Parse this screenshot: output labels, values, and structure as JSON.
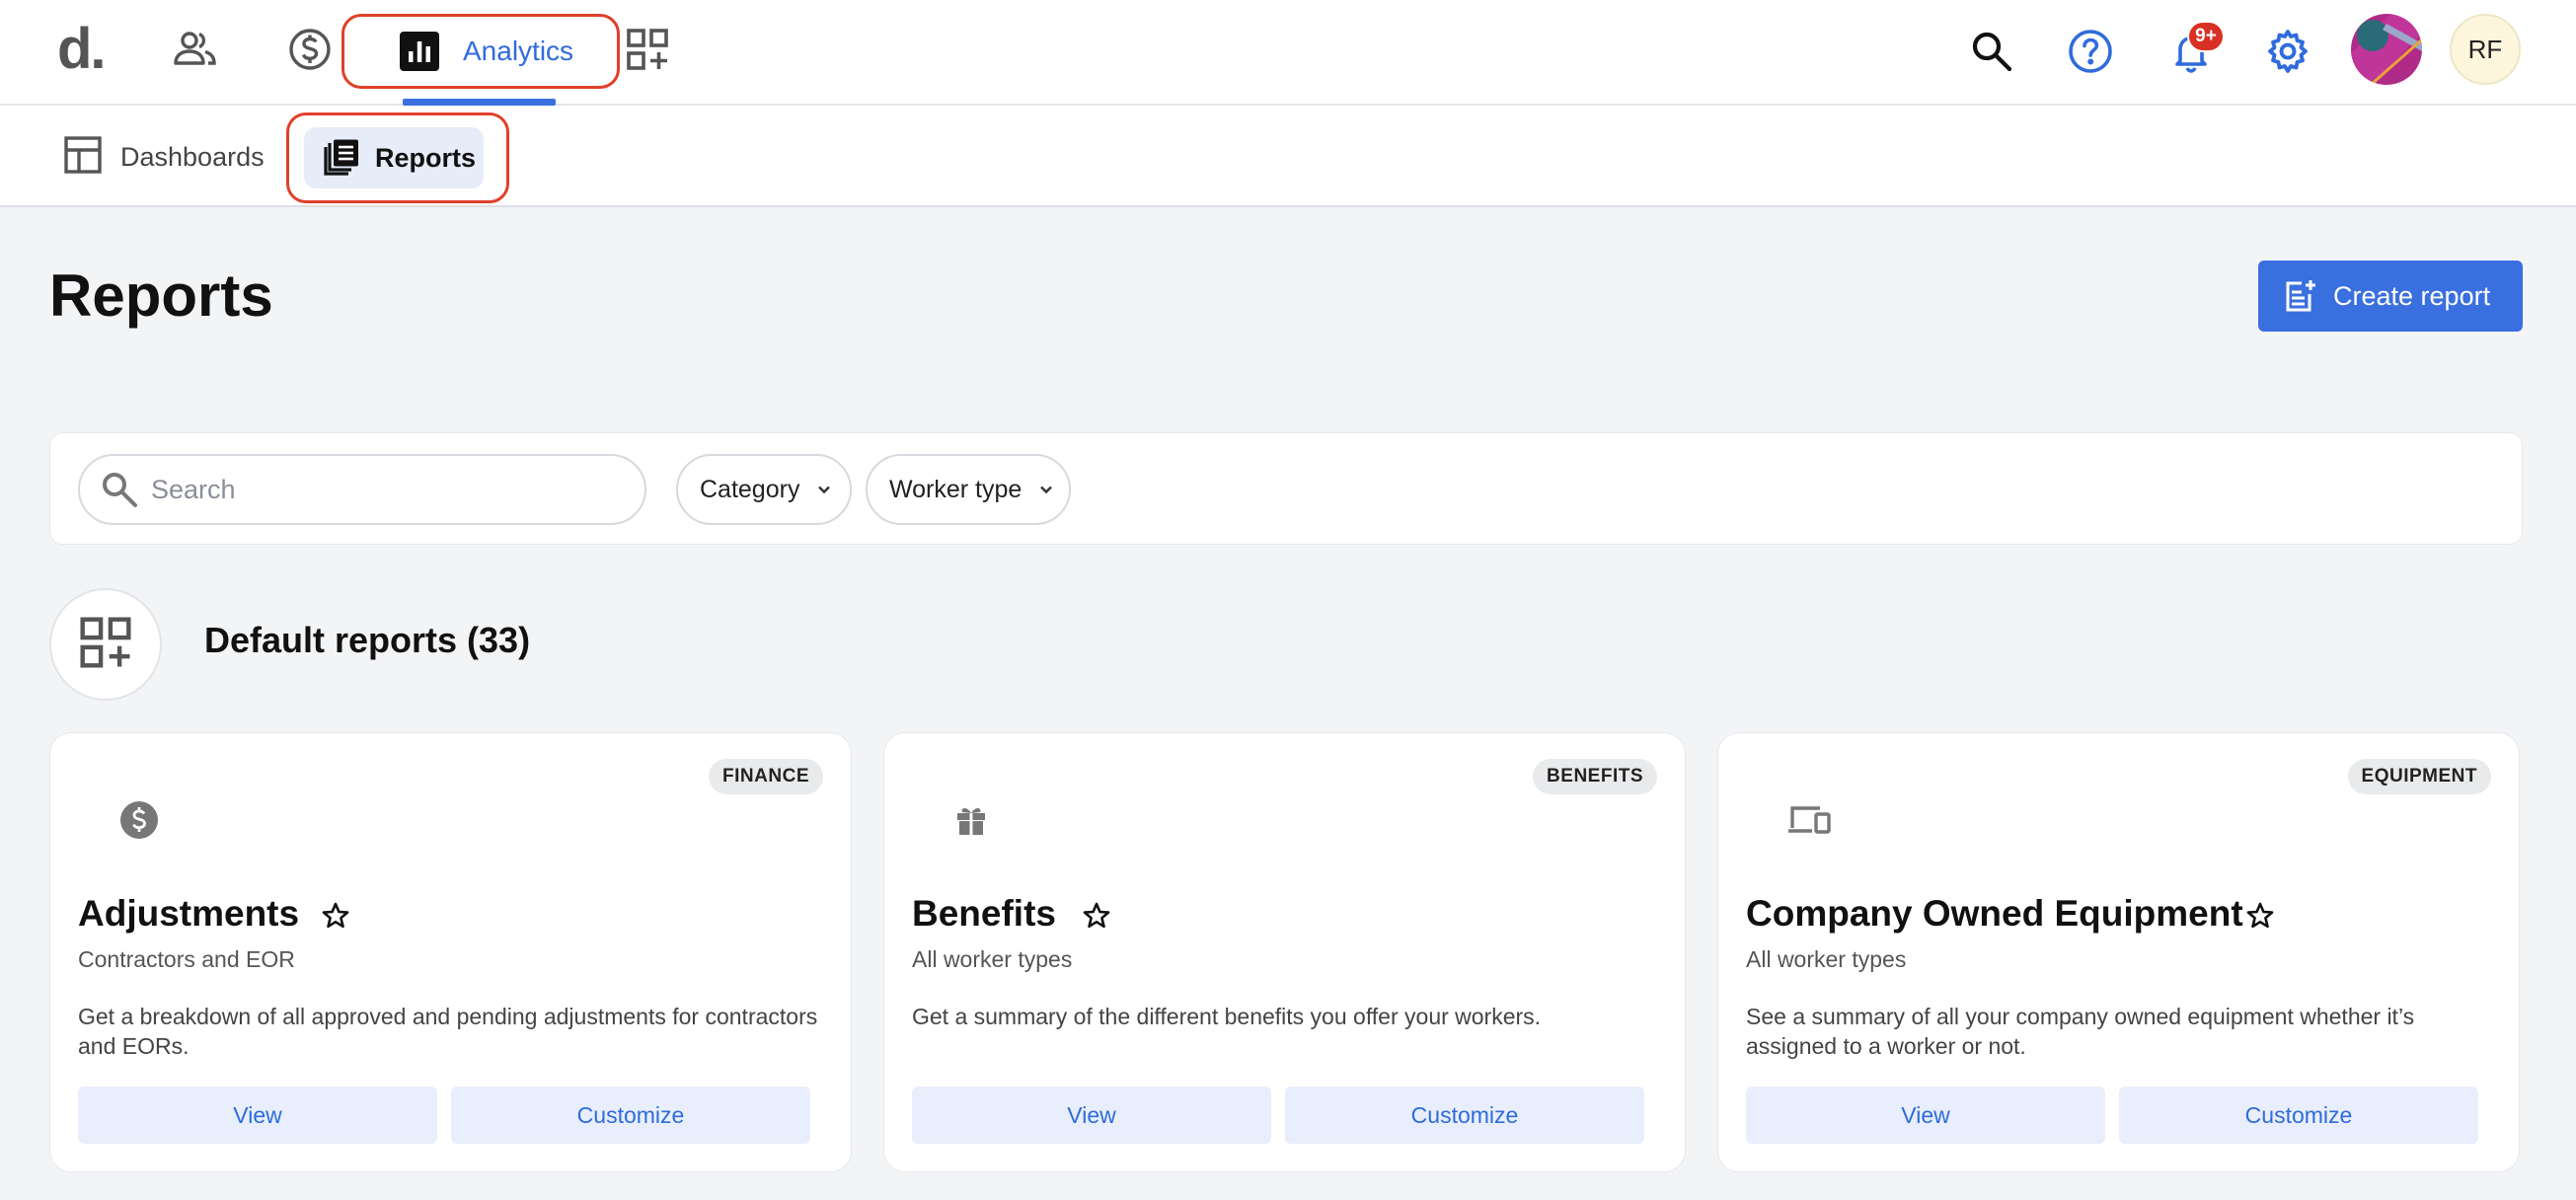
{
  "topnav": {
    "logo": "d.",
    "icons": [
      {
        "name": "people-icon"
      },
      {
        "name": "dollar-circle-icon"
      },
      {
        "name": "add-apps-icon"
      }
    ],
    "active_tab_label": "Analytics",
    "notification_badge": "9+",
    "user_initials": "RF"
  },
  "subnav": {
    "tabs": [
      {
        "label": "Dashboards",
        "icon": "dashboard-layout-icon",
        "active": false
      },
      {
        "label": "Reports",
        "icon": "reports-icon",
        "active": true
      }
    ]
  },
  "page": {
    "title": "Reports",
    "create_button_label": "Create report"
  },
  "filters": {
    "search_placeholder": "Search",
    "search_value": "",
    "category_label": "Category",
    "worker_type_label": "Worker type"
  },
  "section": {
    "title": "Default reports (33)"
  },
  "cards": [
    {
      "category": "FINANCE",
      "icon": "dollar-coin-icon",
      "title": "Adjustments",
      "subtitle": "Contractors and EOR",
      "description": "Get a breakdown of all approved and pending adjustments for contractors and EORs.",
      "view_label": "View",
      "customize_label": "Customize"
    },
    {
      "category": "BENEFITS",
      "icon": "gift-icon",
      "title": "Benefits",
      "subtitle": "All worker types",
      "description": "Get a summary of the different benefits you offer your workers.",
      "view_label": "View",
      "customize_label": "Customize"
    },
    {
      "category": "EQUIPMENT",
      "icon": "devices-icon",
      "title": "Company Owned Equipment",
      "subtitle": "All worker types",
      "description": "See a summary of all your company owned equipment whether it’s assigned to a worker or not.",
      "view_label": "View",
      "customize_label": "Customize"
    }
  ],
  "colors": {
    "accent": "#3a6fe0",
    "highlight_outline": "#e0402a",
    "page_background": "#f3f4f6",
    "button_soft": "#e8eefb",
    "badge_red": "#d93025"
  }
}
